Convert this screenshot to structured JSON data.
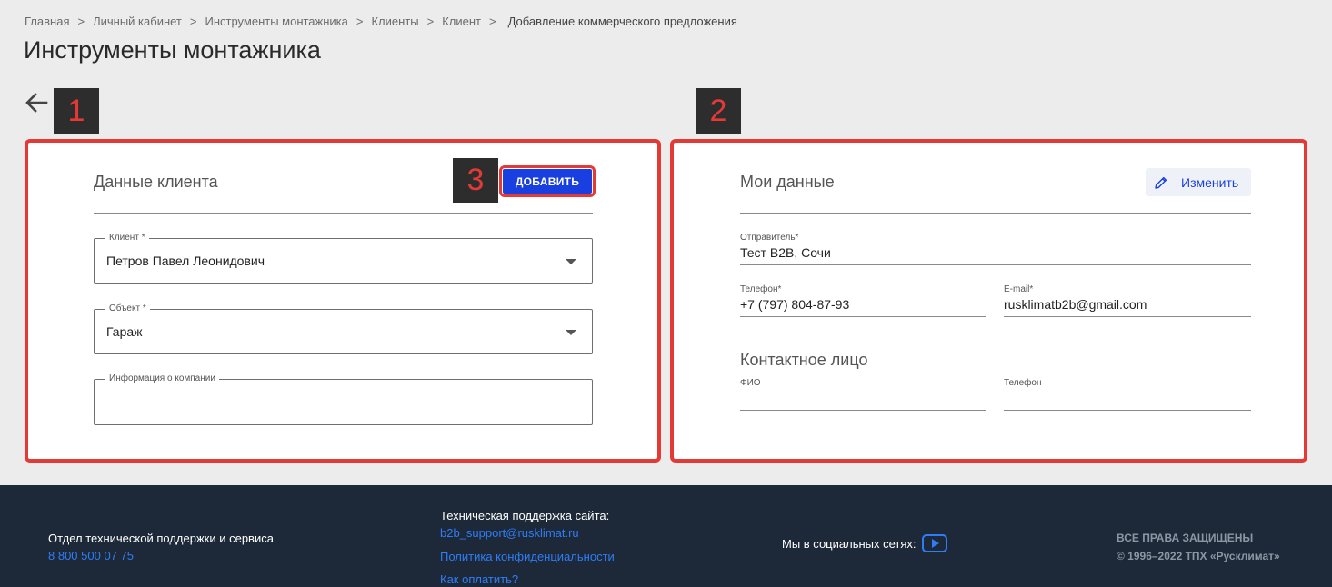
{
  "breadcrumb": {
    "items": [
      "Главная",
      "Личный кабинет",
      "Инструменты монтажника",
      "Клиенты",
      "Клиент"
    ],
    "current": "Добавление коммерческого предложения",
    "separator": ">"
  },
  "page": {
    "title": "Инструменты монтажника"
  },
  "markers": {
    "m1": "1",
    "m2": "2",
    "m3": "3"
  },
  "client_card": {
    "title": "Данные клиента",
    "add_button": "ДОБАВИТЬ",
    "client_field": {
      "label": "Клиент *",
      "value": "Петров Павел Леонидович"
    },
    "object_field": {
      "label": "Объект *",
      "value": "Гараж"
    },
    "company_field": {
      "label": "Информация о компании",
      "value": ""
    }
  },
  "my_card": {
    "title": "Мои данные",
    "edit_button": "Изменить",
    "sender": {
      "label": "Отправитель*",
      "value": "Тест B2B, Сочи"
    },
    "phone": {
      "label": "Телефон*",
      "value": "+7 (797) 804-87-93"
    },
    "email": {
      "label": "E-mail*",
      "value": "rusklimatb2b@gmail.com"
    },
    "contact_title": "Контактное лицо",
    "contact_name": {
      "label": "ФИО",
      "value": ""
    },
    "contact_phone": {
      "label": "Телефон",
      "value": ""
    }
  },
  "footer": {
    "support_dept": "Отдел технической поддержки и сервиса",
    "support_phone": "8 800 500 07 75",
    "tech_support_title": "Техническая поддержка сайта:",
    "tech_support_email": "b2b_support@rusklimat.ru",
    "privacy_link": "Политика конфиденциальности",
    "pay_link": "Как оплатить?",
    "social_label": "Мы в социальных сетях:",
    "rights": "ВСЕ ПРАВА ЗАЩИЩЕНЫ",
    "copyright": "© 1996–2022 ТПХ «Русклимат»"
  },
  "colors": {
    "accent_blue": "#1a3fe0",
    "highlight_red": "#e53935",
    "footer_bg": "#1d2939",
    "link_blue": "#2f7df6"
  },
  "icons": {
    "back": "arrow-left-icon",
    "edit": "pencil-icon",
    "dropdown": "caret-down-icon",
    "social": "youtube-icon"
  }
}
